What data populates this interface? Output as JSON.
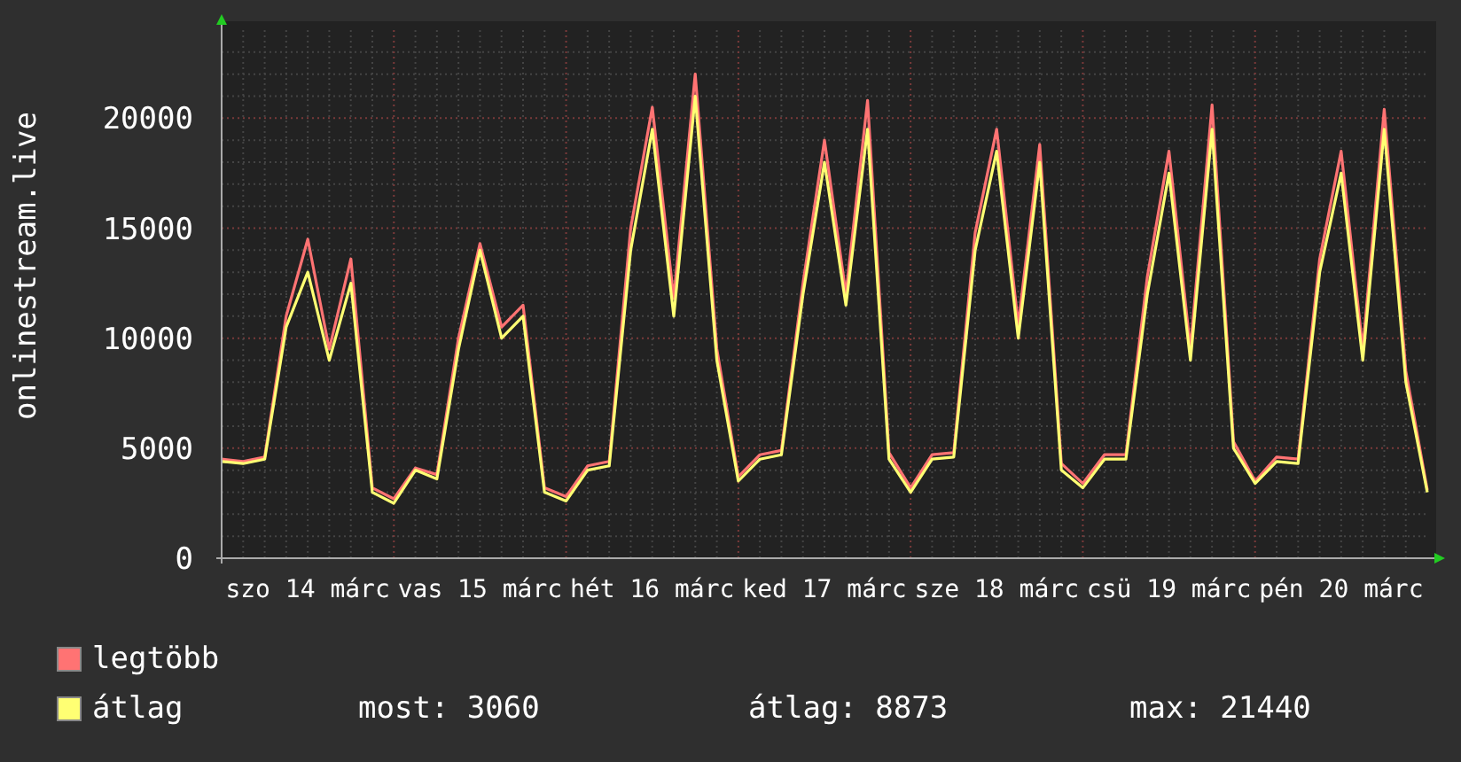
{
  "chart_data": {
    "type": "line",
    "ylabel": "onlinestream.live",
    "grid": true,
    "ylim": [
      0,
      24000
    ],
    "yticks": [
      0,
      5000,
      10000,
      15000,
      20000
    ],
    "categories": [
      null,
      null,
      null,
      null,
      "szo 14 márc",
      null,
      null,
      null,
      null,
      null,
      null,
      null,
      "vas 15 márc",
      null,
      null,
      null,
      null,
      null,
      null,
      null,
      "hét 16 márc",
      null,
      null,
      null,
      null,
      null,
      null,
      null,
      "ked 17 márc",
      null,
      null,
      null,
      null,
      null,
      null,
      null,
      "sze 18 márc",
      null,
      null,
      null,
      null,
      null,
      null,
      null,
      "csü 19 márc",
      null,
      null,
      null,
      null,
      null,
      null,
      null,
      "pén 20 márc",
      null,
      null,
      null,
      null
    ],
    "series": [
      {
        "name": "legtöbb",
        "color": "#ff7373",
        "values": [
          4500,
          4400,
          4600,
          11000,
          14500,
          9500,
          13600,
          3200,
          2700,
          4100,
          3800,
          10000,
          14300,
          10500,
          11500,
          3200,
          2800,
          4200,
          4400,
          15000,
          20500,
          11800,
          22000,
          9500,
          3700,
          4700,
          4900,
          12500,
          19000,
          12000,
          20800,
          4800,
          3200,
          4700,
          4800,
          14800,
          19500,
          10600,
          18800,
          4300,
          3400,
          4700,
          4700,
          12800,
          18500,
          9500,
          20600,
          5300,
          3500,
          4600,
          4500,
          13600,
          18500,
          9500,
          20400,
          8500,
          3100
        ]
      },
      {
        "name": "átlag",
        "color": "#ffff73",
        "values": [
          4400,
          4300,
          4500,
          10500,
          13000,
          9000,
          12500,
          3000,
          2500,
          4000,
          3600,
          9500,
          14000,
          10000,
          11000,
          3000,
          2600,
          4000,
          4200,
          14000,
          19500,
          11000,
          21000,
          9000,
          3500,
          4500,
          4700,
          12000,
          18000,
          11500,
          19500,
          4500,
          3000,
          4500,
          4600,
          14000,
          18500,
          10000,
          18000,
          4000,
          3200,
          4500,
          4500,
          12000,
          17500,
          9000,
          19500,
          5000,
          3400,
          4400,
          4300,
          13000,
          17500,
          9000,
          19500,
          8000,
          3000
        ]
      }
    ]
  },
  "stats": [
    "most: 3060",
    "átlag: 8873",
    "max: 21440"
  ]
}
